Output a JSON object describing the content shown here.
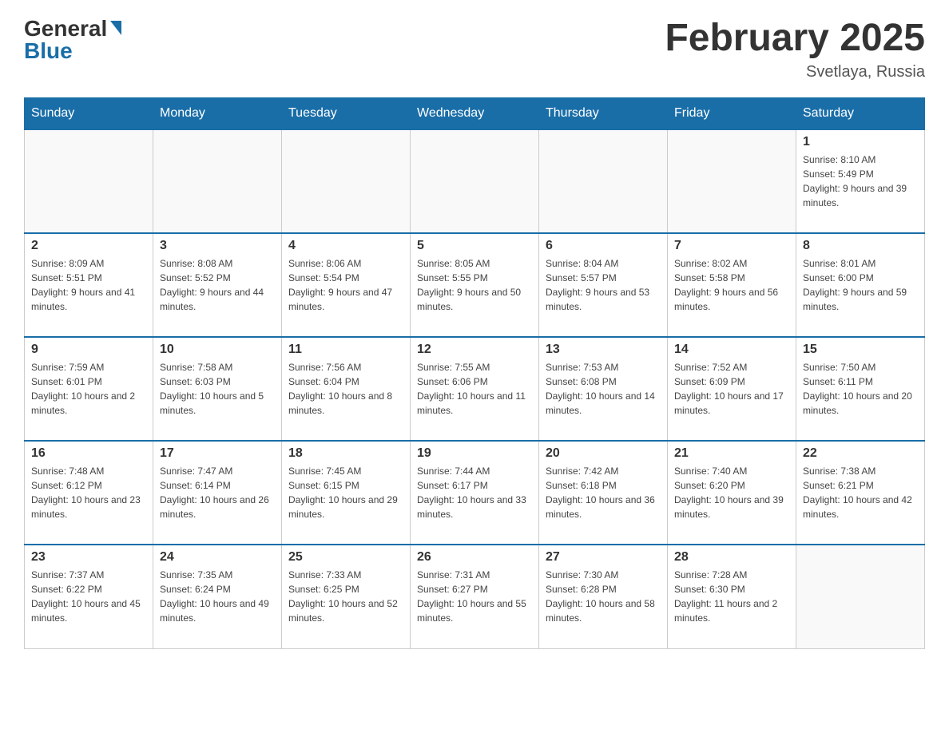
{
  "header": {
    "logo_general": "General",
    "logo_blue": "Blue",
    "month_title": "February 2025",
    "location": "Svetlaya, Russia"
  },
  "weekdays": [
    "Sunday",
    "Monday",
    "Tuesday",
    "Wednesday",
    "Thursday",
    "Friday",
    "Saturday"
  ],
  "weeks": [
    [
      {
        "day": "",
        "info": ""
      },
      {
        "day": "",
        "info": ""
      },
      {
        "day": "",
        "info": ""
      },
      {
        "day": "",
        "info": ""
      },
      {
        "day": "",
        "info": ""
      },
      {
        "day": "",
        "info": ""
      },
      {
        "day": "1",
        "info": "Sunrise: 8:10 AM\nSunset: 5:49 PM\nDaylight: 9 hours and 39 minutes."
      }
    ],
    [
      {
        "day": "2",
        "info": "Sunrise: 8:09 AM\nSunset: 5:51 PM\nDaylight: 9 hours and 41 minutes."
      },
      {
        "day": "3",
        "info": "Sunrise: 8:08 AM\nSunset: 5:52 PM\nDaylight: 9 hours and 44 minutes."
      },
      {
        "day": "4",
        "info": "Sunrise: 8:06 AM\nSunset: 5:54 PM\nDaylight: 9 hours and 47 minutes."
      },
      {
        "day": "5",
        "info": "Sunrise: 8:05 AM\nSunset: 5:55 PM\nDaylight: 9 hours and 50 minutes."
      },
      {
        "day": "6",
        "info": "Sunrise: 8:04 AM\nSunset: 5:57 PM\nDaylight: 9 hours and 53 minutes."
      },
      {
        "day": "7",
        "info": "Sunrise: 8:02 AM\nSunset: 5:58 PM\nDaylight: 9 hours and 56 minutes."
      },
      {
        "day": "8",
        "info": "Sunrise: 8:01 AM\nSunset: 6:00 PM\nDaylight: 9 hours and 59 minutes."
      }
    ],
    [
      {
        "day": "9",
        "info": "Sunrise: 7:59 AM\nSunset: 6:01 PM\nDaylight: 10 hours and 2 minutes."
      },
      {
        "day": "10",
        "info": "Sunrise: 7:58 AM\nSunset: 6:03 PM\nDaylight: 10 hours and 5 minutes."
      },
      {
        "day": "11",
        "info": "Sunrise: 7:56 AM\nSunset: 6:04 PM\nDaylight: 10 hours and 8 minutes."
      },
      {
        "day": "12",
        "info": "Sunrise: 7:55 AM\nSunset: 6:06 PM\nDaylight: 10 hours and 11 minutes."
      },
      {
        "day": "13",
        "info": "Sunrise: 7:53 AM\nSunset: 6:08 PM\nDaylight: 10 hours and 14 minutes."
      },
      {
        "day": "14",
        "info": "Sunrise: 7:52 AM\nSunset: 6:09 PM\nDaylight: 10 hours and 17 minutes."
      },
      {
        "day": "15",
        "info": "Sunrise: 7:50 AM\nSunset: 6:11 PM\nDaylight: 10 hours and 20 minutes."
      }
    ],
    [
      {
        "day": "16",
        "info": "Sunrise: 7:48 AM\nSunset: 6:12 PM\nDaylight: 10 hours and 23 minutes."
      },
      {
        "day": "17",
        "info": "Sunrise: 7:47 AM\nSunset: 6:14 PM\nDaylight: 10 hours and 26 minutes."
      },
      {
        "day": "18",
        "info": "Sunrise: 7:45 AM\nSunset: 6:15 PM\nDaylight: 10 hours and 29 minutes."
      },
      {
        "day": "19",
        "info": "Sunrise: 7:44 AM\nSunset: 6:17 PM\nDaylight: 10 hours and 33 minutes."
      },
      {
        "day": "20",
        "info": "Sunrise: 7:42 AM\nSunset: 6:18 PM\nDaylight: 10 hours and 36 minutes."
      },
      {
        "day": "21",
        "info": "Sunrise: 7:40 AM\nSunset: 6:20 PM\nDaylight: 10 hours and 39 minutes."
      },
      {
        "day": "22",
        "info": "Sunrise: 7:38 AM\nSunset: 6:21 PM\nDaylight: 10 hours and 42 minutes."
      }
    ],
    [
      {
        "day": "23",
        "info": "Sunrise: 7:37 AM\nSunset: 6:22 PM\nDaylight: 10 hours and 45 minutes."
      },
      {
        "day": "24",
        "info": "Sunrise: 7:35 AM\nSunset: 6:24 PM\nDaylight: 10 hours and 49 minutes."
      },
      {
        "day": "25",
        "info": "Sunrise: 7:33 AM\nSunset: 6:25 PM\nDaylight: 10 hours and 52 minutes."
      },
      {
        "day": "26",
        "info": "Sunrise: 7:31 AM\nSunset: 6:27 PM\nDaylight: 10 hours and 55 minutes."
      },
      {
        "day": "27",
        "info": "Sunrise: 7:30 AM\nSunset: 6:28 PM\nDaylight: 10 hours and 58 minutes."
      },
      {
        "day": "28",
        "info": "Sunrise: 7:28 AM\nSunset: 6:30 PM\nDaylight: 11 hours and 2 minutes."
      },
      {
        "day": "",
        "info": ""
      }
    ]
  ]
}
